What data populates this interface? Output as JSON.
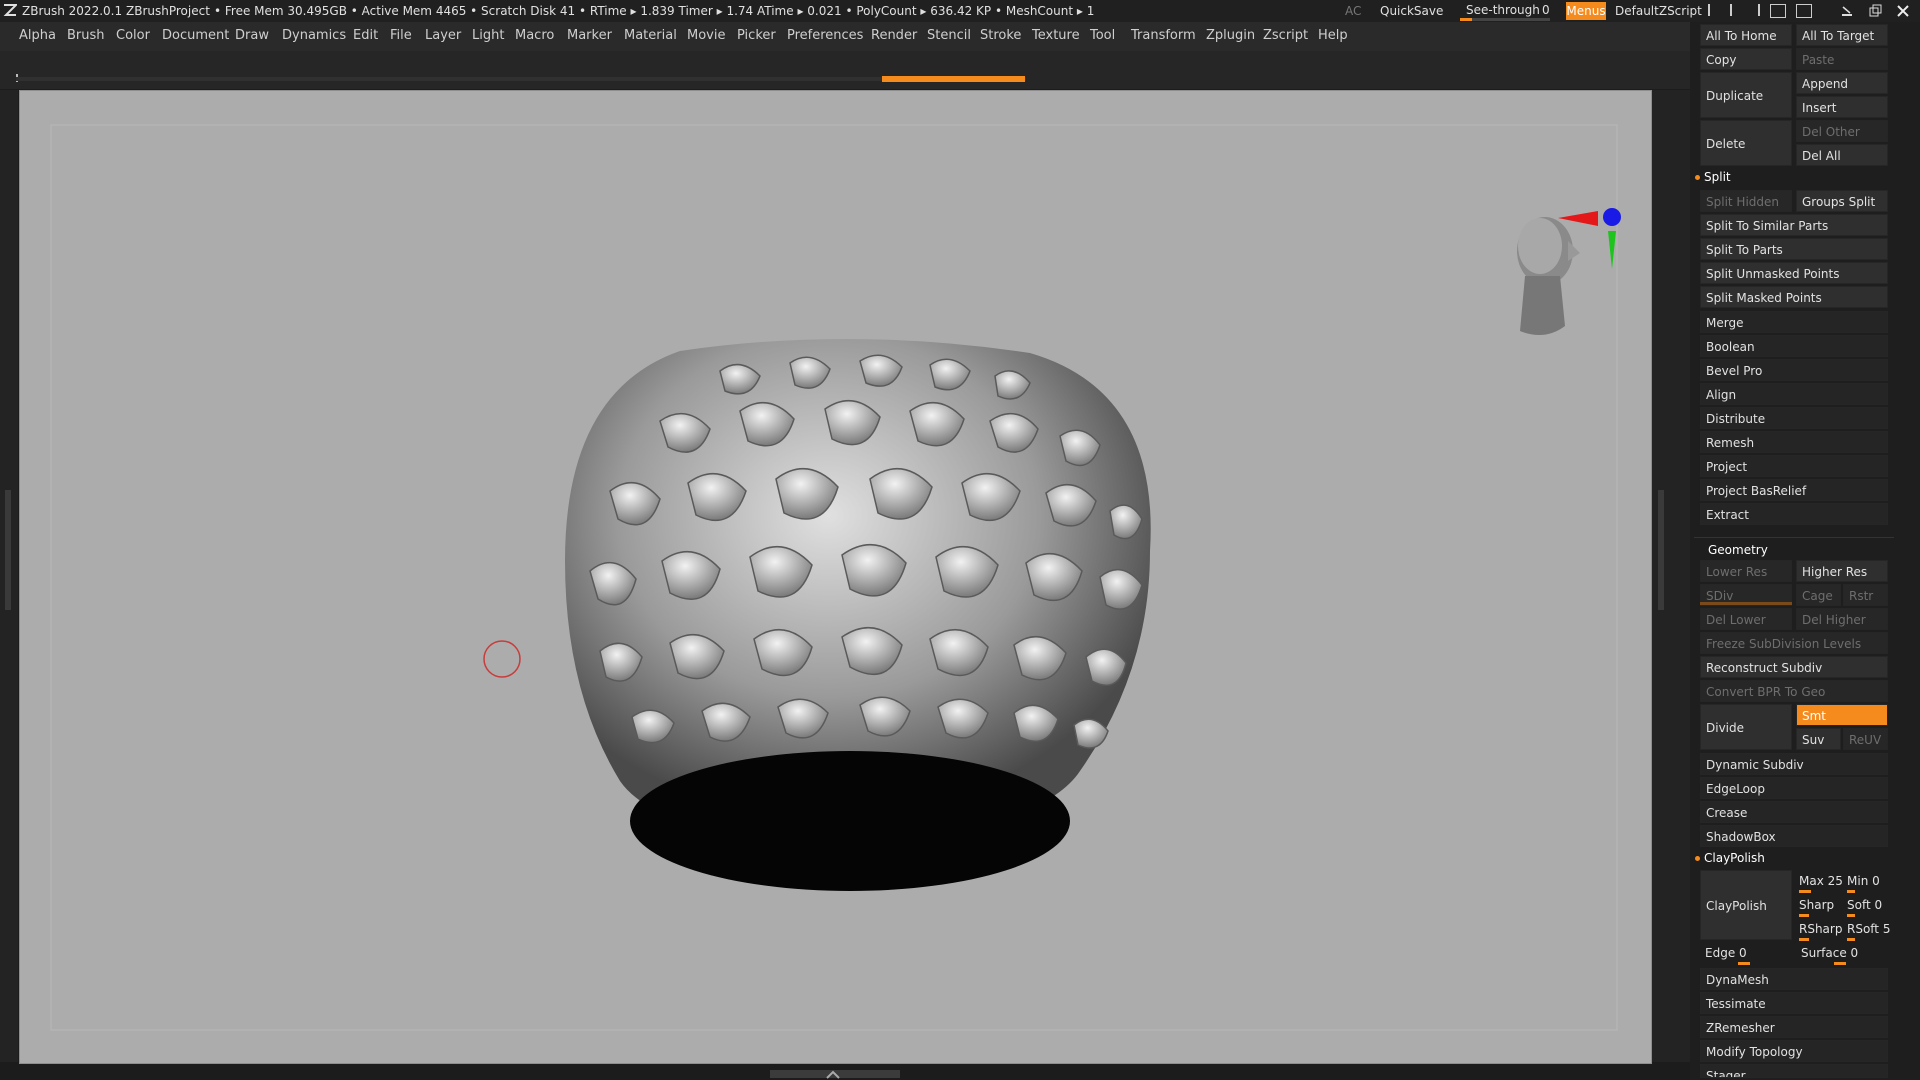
{
  "titlebar": {
    "app": "ZBrush 2022.0.1",
    "project": "ZBrushProject",
    "stats": "• Free Mem 30.495GB • Active Mem 4465 • Scratch Disk 41 • RTime ▸ 1.839 Timer ▸ 1.74 ATime ▸ 0.021 • PolyCount ▸ 636.42 KP • MeshCount ▸ 1",
    "ac": "AC",
    "quicksave": "QuickSave",
    "seethrough": "See-through",
    "seethrough_value": "0",
    "menus": "Menus",
    "script": "DefaultZScript"
  },
  "menubar": [
    "Alpha",
    "Brush",
    "Color",
    "Document",
    "Draw",
    "Dynamics",
    "Edit",
    "File",
    "Layer",
    "Light",
    "Macro",
    "Marker",
    "Material",
    "Movie",
    "Picker",
    "Preferences",
    "Render",
    "Stencil",
    "Stroke",
    "Texture",
    "Tool",
    "Transform",
    "Zplugin",
    "Zscript",
    "Help"
  ],
  "subtool": {
    "all_to_home": "All To Home",
    "all_to_target": "All To Target",
    "copy": "Copy",
    "paste": "Paste",
    "duplicate": "Duplicate",
    "append": "Append",
    "insert": "Insert",
    "delete": "Delete",
    "del_other": "Del Other",
    "del_all": "Del All",
    "split": "Split",
    "split_hidden": "Split Hidden",
    "groups_split": "Groups Split",
    "split_similar": "Split To Similar Parts",
    "split_parts": "Split To Parts",
    "split_unmasked": "Split Unmasked Points",
    "split_masked": "Split Masked Points",
    "merge": "Merge",
    "boolean": "Boolean",
    "bevel_pro": "Bevel Pro",
    "align": "Align",
    "distribute": "Distribute",
    "remesh": "Remesh",
    "project": "Project",
    "project_basrelief": "Project BasRelief",
    "extract": "Extract"
  },
  "geometry": {
    "title": "Geometry",
    "lower_res": "Lower Res",
    "higher_res": "Higher Res",
    "sdiv": "SDiv",
    "cage": "Cage",
    "rstr": "Rstr",
    "del_lower": "Del Lower",
    "del_higher": "Del Higher",
    "freeze": "Freeze SubDivision Levels",
    "reconstruct": "Reconstruct Subdiv",
    "convert_bpr": "Convert BPR To Geo",
    "divide": "Divide",
    "smt": "Smt",
    "suv": "Suv",
    "reuv": "ReUV",
    "dynamic_subdiv": "Dynamic Subdiv",
    "edgeloop": "EdgeLoop",
    "crease": "Crease",
    "shadowbox": "ShadowBox",
    "claypolish_head": "ClayPolish",
    "claypolish": "ClayPolish",
    "max": "Max 25",
    "min": "Min 0",
    "sharp": "Sharp",
    "soft": "Soft 0",
    "rsharp": "RSharp",
    "rsoft": "RSoft 5",
    "edge": "Edge 0",
    "surface": "Surface 0",
    "dynamesh": "DynaMesh",
    "tessimate": "Tessimate",
    "zremesher": "ZRemesher",
    "modify_topology": "Modify Topology",
    "stager": "Stager"
  },
  "colors": {
    "accent": "#f58a1d",
    "viewport": "#acacac",
    "panel": "#1e1e1e"
  },
  "icons": [
    "zbrush-logo-icon",
    "head-orientation-icon",
    "gizmo-axis-icon",
    "brush-cursor-icon",
    "minimize-icon",
    "restore-icon",
    "close-icon"
  ]
}
